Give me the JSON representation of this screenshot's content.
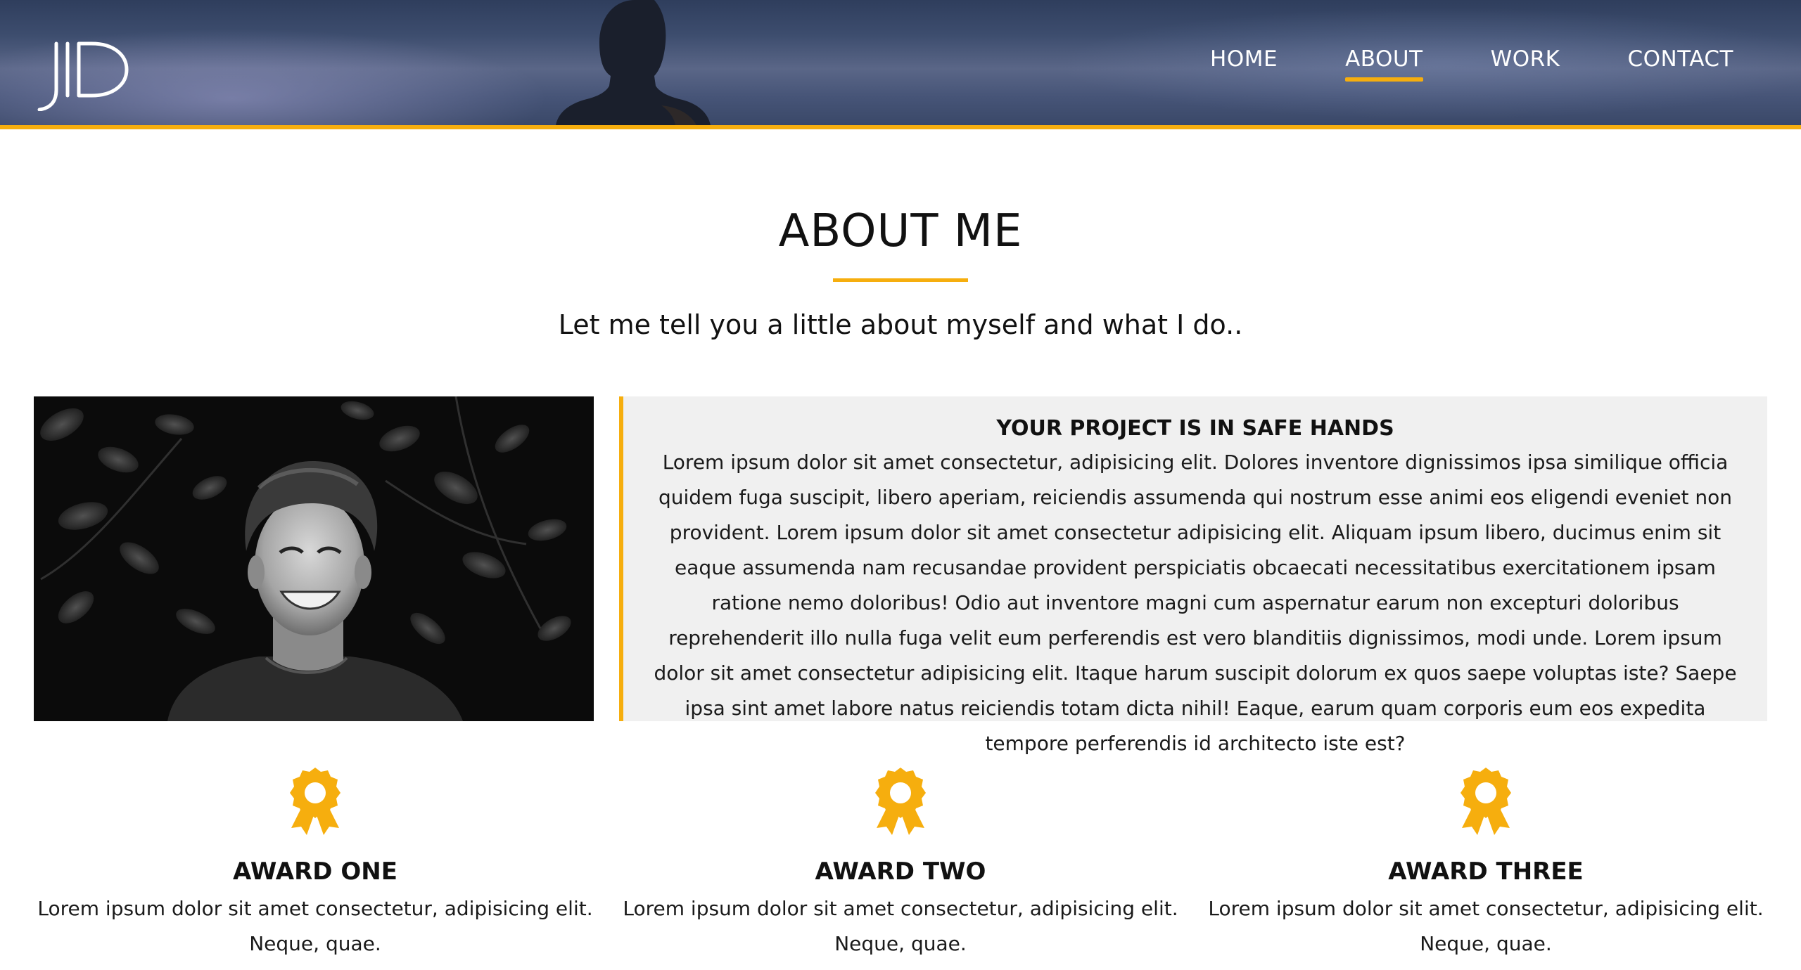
{
  "header": {
    "logo_text": "JD",
    "nav": [
      {
        "label": "HOME",
        "active": false
      },
      {
        "label": "ABOUT",
        "active": true
      },
      {
        "label": "WORK",
        "active": false
      },
      {
        "label": "CONTACT",
        "active": false
      }
    ],
    "accent_color": "#f6ae0e"
  },
  "intro": {
    "title": "ABOUT ME",
    "subtitle": "Let me tell you a little about myself and what I do.."
  },
  "feature": {
    "heading": "YOUR PROJECT IS IN SAFE HANDS",
    "body": "Lorem ipsum dolor sit amet consectetur, adipisicing elit. Dolores inventore dignissimos ipsa similique officia quidem fuga suscipit, libero aperiam, reiciendis assumenda qui nostrum esse animi eos eligendi eveniet non provident. Lorem ipsum dolor sit amet consectetur adipisicing elit. Aliquam ipsum libero, ducimus enim sit eaque assumenda nam recusandae provident perspiciatis obcaecati necessitatibus exercitationem ipsam ratione nemo doloribus! Odio aut inventore magni cum aspernatur earum non excepturi doloribus reprehenderit illo nulla fuga velit eum perferendis est vero blanditiis dignissimos, modi unde. Lorem ipsum dolor sit amet consectetur adipisicing elit. Itaque harum suscipit dolorum ex quos saepe voluptas iste? Saepe ipsa sint amet labore natus reiciendis totam dicta nihil! Eaque, earum quam corporis eum eos expedita tempore perferendis id architecto iste est?"
  },
  "awards": [
    {
      "icon": "award-ribbon-icon",
      "title": "AWARD ONE",
      "text": "Lorem ipsum dolor sit amet consectetur, adipisicing elit. Neque, quae."
    },
    {
      "icon": "award-ribbon-icon",
      "title": "AWARD TWO",
      "text": "Lorem ipsum dolor sit amet consectetur, adipisicing elit. Neque, quae."
    },
    {
      "icon": "award-ribbon-icon",
      "title": "AWARD THREE",
      "text": "Lorem ipsum dolor sit amet consectetur, adipisicing elit. Neque, quae."
    }
  ]
}
